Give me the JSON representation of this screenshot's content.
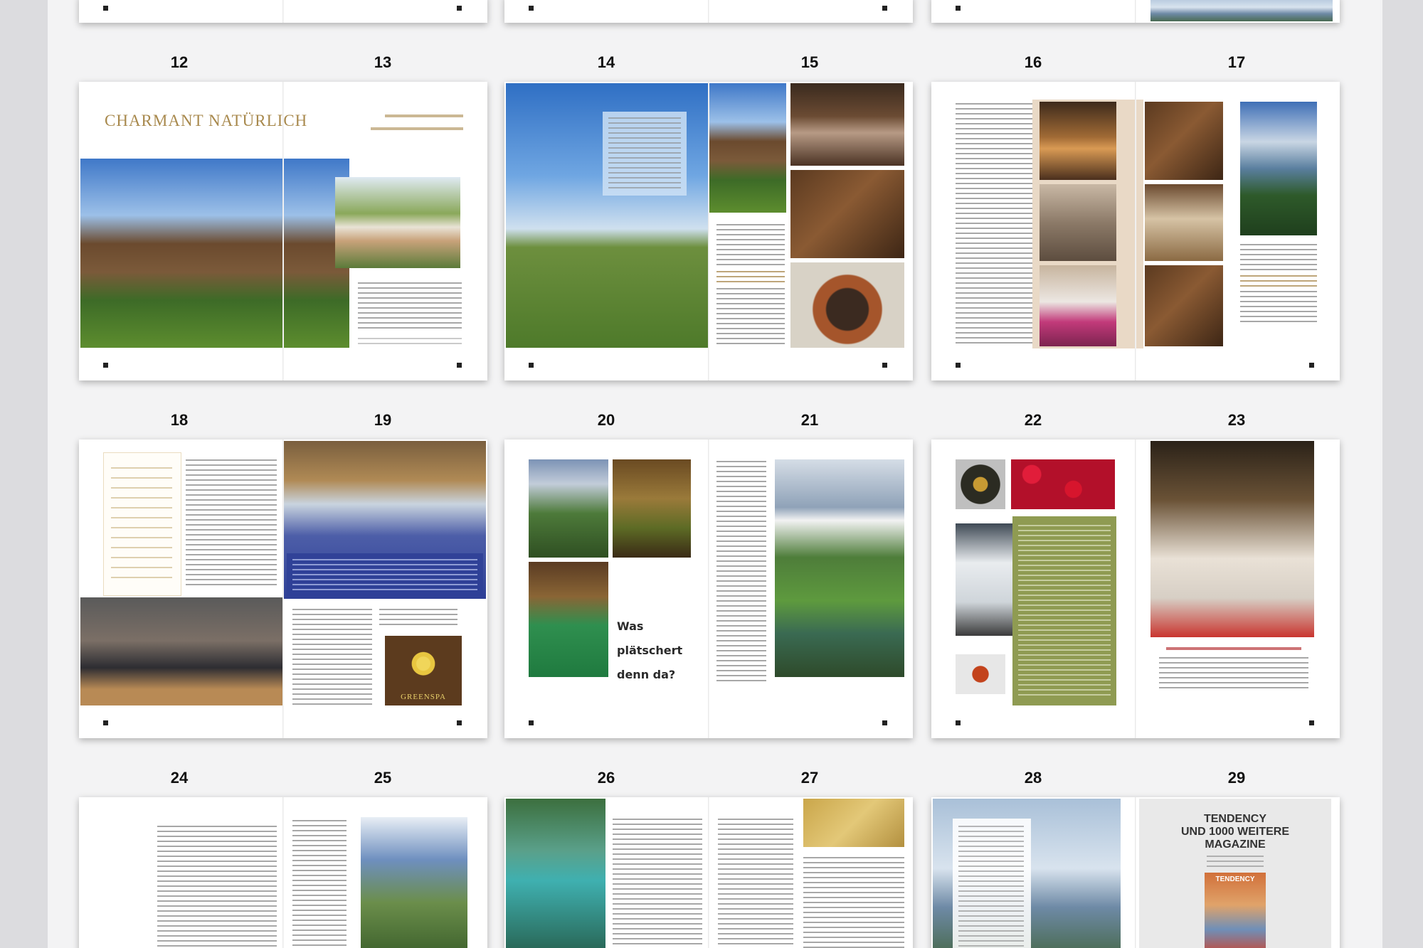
{
  "pages": [
    "12",
    "13",
    "14",
    "15",
    "16",
    "17",
    "18",
    "19",
    "20",
    "21",
    "22",
    "23",
    "24",
    "25",
    "26",
    "27",
    "28",
    "29"
  ],
  "spreads": {
    "s12": {
      "title": "CHARMANT NATÜRLICH"
    },
    "s20": {
      "headline_line1": "Was",
      "headline_line2": "plätschert",
      "headline_line3": "denn da?"
    },
    "s18_19": {
      "logo": "GREENSPA"
    },
    "s28_29": {
      "ad_line1": "TENDENCY",
      "ad_line2": "UND 1000 WEITERE",
      "ad_line3": "MAGAZINE",
      "cover_title": "TENDENCY"
    }
  },
  "colors": {
    "background": "#f3f3f4",
    "olive": "#8f9b52",
    "gold": "#a8894d",
    "sidebar": "#dcdcdf"
  }
}
